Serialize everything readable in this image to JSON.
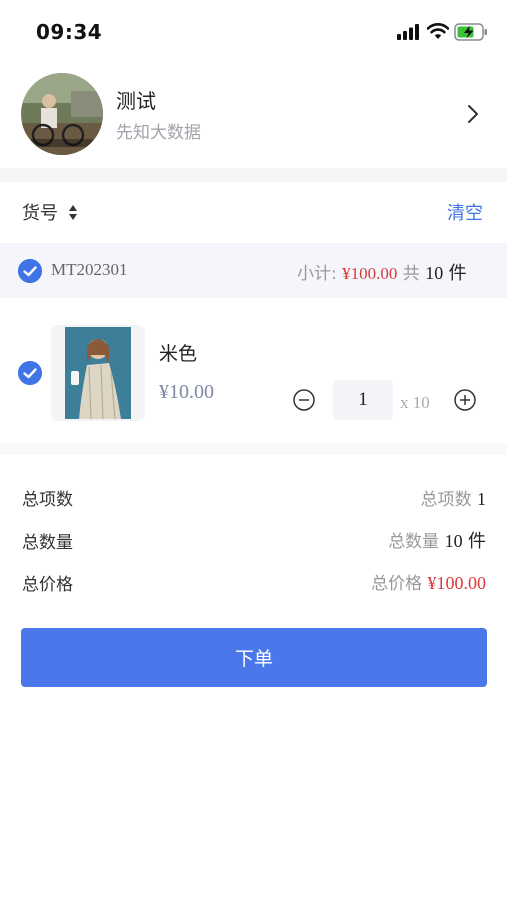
{
  "status_bar": {
    "time": "09:34"
  },
  "profile": {
    "name": "测试",
    "subtitle": "先知大数据"
  },
  "sort": {
    "label": "货号"
  },
  "actions": {
    "clear_label": "清空",
    "order_label": "下单"
  },
  "group": {
    "code": "MT202301",
    "subtotal_label": "小计:",
    "subtotal_price": "¥100.00",
    "count_prefix": "共",
    "count_value": "10",
    "count_unit": "件",
    "checked": true
  },
  "item": {
    "name": "米色",
    "price": "¥10.00",
    "quantity": "1",
    "multiplier": "x 10",
    "checked": true
  },
  "summary": {
    "items_label": "总项数",
    "items_right_label": "总项数",
    "items_value": "1",
    "qty_label": "总数量",
    "qty_right_label": "总数量",
    "qty_value": "10",
    "qty_unit": "件",
    "price_label": "总价格",
    "price_right_label": "总价格",
    "price_value": "¥100.00"
  },
  "colors": {
    "accent": "#3f74e6",
    "button": "#4a77ea",
    "price_red": "#d9383a"
  }
}
